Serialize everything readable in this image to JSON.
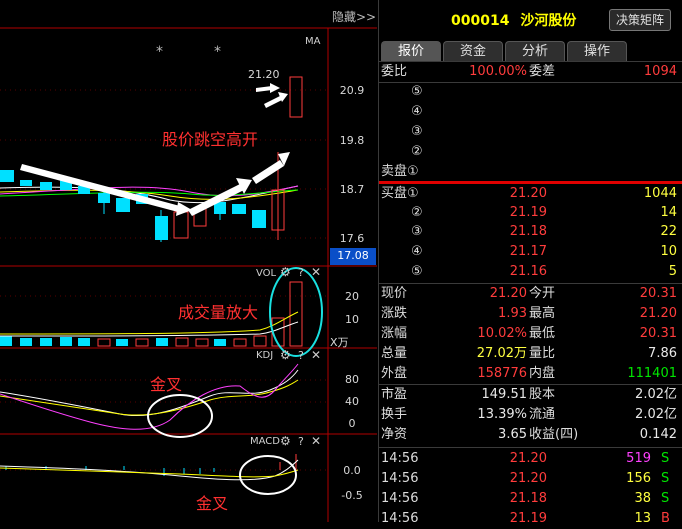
{
  "topbar": {
    "hide_label": "隐藏>>"
  },
  "stock": {
    "code": "000014",
    "name": "沙河股份",
    "decision_button": "决策矩阵"
  },
  "tabs": [
    {
      "label": "报价"
    },
    {
      "label": "资金"
    },
    {
      "label": "分析"
    },
    {
      "label": "操作"
    }
  ],
  "order_stats": {
    "weibi_label": "委比",
    "weibi_value": "100.00%",
    "weicha_label": "委差",
    "weicha_value": "1094"
  },
  "sell_levels": [
    {
      "label": "⑤",
      "price": "",
      "vol": ""
    },
    {
      "label": "④",
      "price": "",
      "vol": ""
    },
    {
      "label": "③",
      "price": "",
      "vol": ""
    },
    {
      "label": "②",
      "price": "",
      "vol": ""
    },
    {
      "label": "卖盘①",
      "price": "",
      "vol": ""
    }
  ],
  "buy_levels": [
    {
      "label": "买盘①",
      "price": "21.20",
      "vol": "1044"
    },
    {
      "label": "②",
      "price": "21.19",
      "vol": "14"
    },
    {
      "label": "③",
      "price": "21.18",
      "vol": "22"
    },
    {
      "label": "④",
      "price": "21.17",
      "vol": "10"
    },
    {
      "label": "⑤",
      "price": "21.16",
      "vol": "5"
    }
  ],
  "quote_rows": [
    {
      "l1": "现价",
      "v1": "21.20",
      "c1": "red",
      "l2": "今开",
      "v2": "20.31",
      "c2": "red"
    },
    {
      "l1": "涨跌",
      "v1": "1.93",
      "c1": "red",
      "l2": "最高",
      "v2": "21.20",
      "c2": "red"
    },
    {
      "l1": "涨幅",
      "v1": "10.02%",
      "c1": "red",
      "l2": "最低",
      "v2": "20.31",
      "c2": "red"
    },
    {
      "l1": "总量",
      "v1": "27.02万",
      "c1": "yellow",
      "l2": "量比",
      "v2": "7.86",
      "c2": "white"
    },
    {
      "l1": "外盘",
      "v1": "158776",
      "c1": "red",
      "l2": "内盘",
      "v2": "111401",
      "c2": "green"
    }
  ],
  "fund_rows": [
    {
      "l1": "市盈",
      "v1": "149.51",
      "l2": "股本",
      "v2": "2.02亿"
    },
    {
      "l1": "换手",
      "v1": "13.39%",
      "l2": "流通",
      "v2": "2.02亿"
    },
    {
      "l1": "净资",
      "v1": "3.65",
      "l2": "收益(四)",
      "v2": "0.142"
    }
  ],
  "trades": [
    {
      "time": "14:56",
      "price": "21.20",
      "vol": "519",
      "vol_color": "magenta",
      "side": "S"
    },
    {
      "time": "14:56",
      "price": "21.20",
      "vol": "156",
      "vol_color": "yellow",
      "side": "S"
    },
    {
      "time": "14:56",
      "price": "21.18",
      "vol": "38",
      "vol_color": "yellow",
      "side": "S"
    },
    {
      "time": "14:56",
      "price": "21.19",
      "vol": "13",
      "vol_color": "yellow",
      "side": "B"
    }
  ],
  "chart": {
    "ma_label": "MA",
    "price_ticks": [
      "20.9",
      "19.8",
      "18.7",
      "17.6"
    ],
    "current_price_tag": "17.08",
    "high_label": "21.20",
    "stars": [
      "*",
      "*"
    ],
    "vol_label": "VOL",
    "vol_ticks": [
      "20",
      "10"
    ],
    "vol_unit": "X万",
    "kdj_label": "KDJ",
    "kdj_ticks": [
      "80",
      "40",
      "0"
    ],
    "macd_label": "MACD",
    "macd_ticks": [
      "0.0",
      "-0.5"
    ],
    "panel_icons": [
      "gear-icon",
      "question-icon",
      "close-icon"
    ],
    "colors": {
      "up": "#ff3c3c",
      "down": "#00e0ff",
      "panel_border": "#b00000",
      "axis_bg": "#0a4fc8"
    }
  },
  "annotations": {
    "gap_up": "股价跳空高开",
    "volume_up": "成交量放大",
    "golden_cross_kdj": "金叉",
    "golden_cross_macd": "金叉"
  }
}
